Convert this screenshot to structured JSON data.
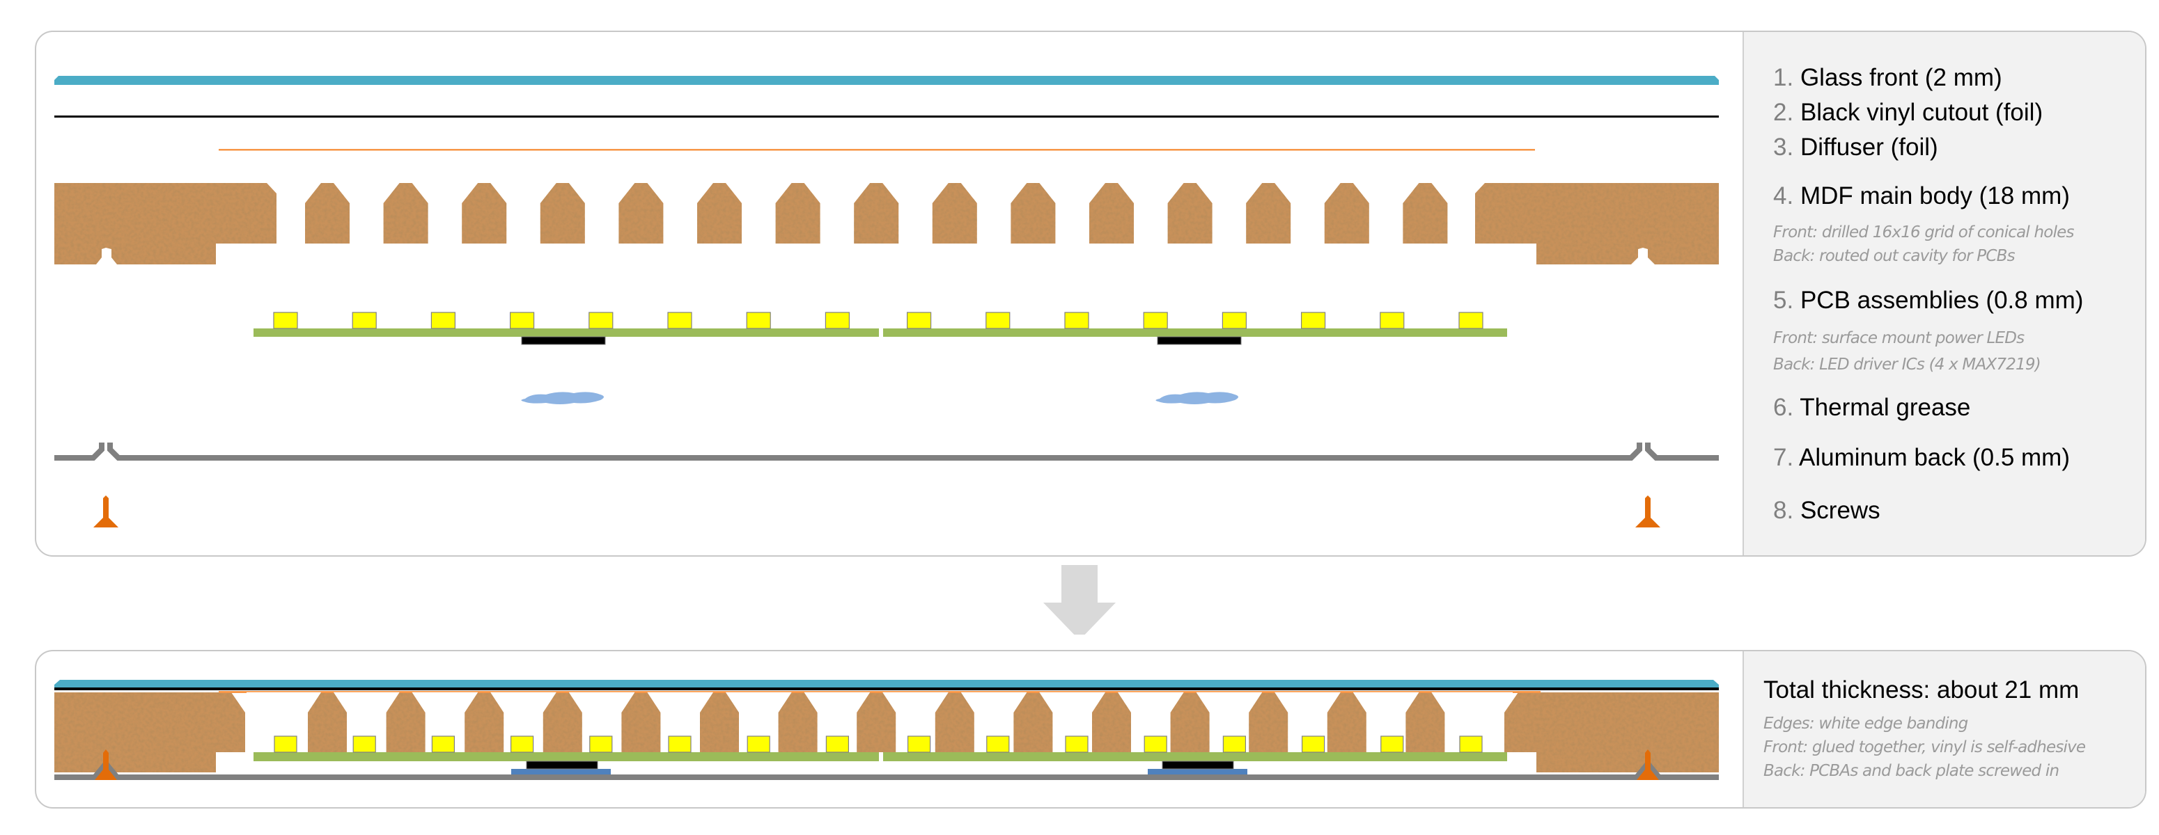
{
  "exploded_view": {
    "legend": [
      {
        "num": "1.",
        "label": "Glass front (2 mm)"
      },
      {
        "num": "2.",
        "label": "Black vinyl cutout (foil)"
      },
      {
        "num": "3.",
        "label": "Diffuser (foil)"
      },
      {
        "num": "4.",
        "label": "MDF main body (18 mm)",
        "notes": [
          {
            "key": "Front:",
            "text": " drilled 16x16 grid of conical holes"
          },
          {
            "key": "Back:",
            "text": " routed out cavity for PCBs"
          }
        ]
      },
      {
        "num": "5.",
        "label": "PCB assemblies (0.8 mm)",
        "notes": [
          {
            "key": "Front:",
            "text": " surface mount power LEDs"
          },
          {
            "key": "Back:",
            "text": " LED driver ICs (4 x MAX7219)"
          }
        ]
      },
      {
        "num": "6.",
        "label": "Thermal grease"
      },
      {
        "num": "7.",
        "label": "Aluminum back (0.5 mm)"
      },
      {
        "num": "8.",
        "label": "Screws"
      }
    ]
  },
  "assembled_view": {
    "title": "Total thickness: about 21 mm",
    "notes": [
      {
        "key": "Edges:",
        "text": " white edge banding"
      },
      {
        "key": "Front:",
        "text": " glued together, vinyl is self-adhesive"
      },
      {
        "key": "Back:",
        "text": " PCBAs and back plate screwed in"
      }
    ]
  },
  "colors": {
    "glass": "#4BACC6",
    "vinyl": "#000000",
    "diffuser": "#F79646",
    "mdf": "#C8915A",
    "pcb": "#9BBB59",
    "led": "#FFFF00",
    "ic": "#000000",
    "grease": "#8DB3E2",
    "aluminum": "#808080",
    "screw": "#E36C09",
    "arrow": "#D9D9D9",
    "thermal_pad": "#4F81BD"
  },
  "structure": {
    "mdf_pillars": 15,
    "leds_per_pcb": 8,
    "pcb_count": 2,
    "driver_ics_visible": 2,
    "screws_visible": 2
  }
}
